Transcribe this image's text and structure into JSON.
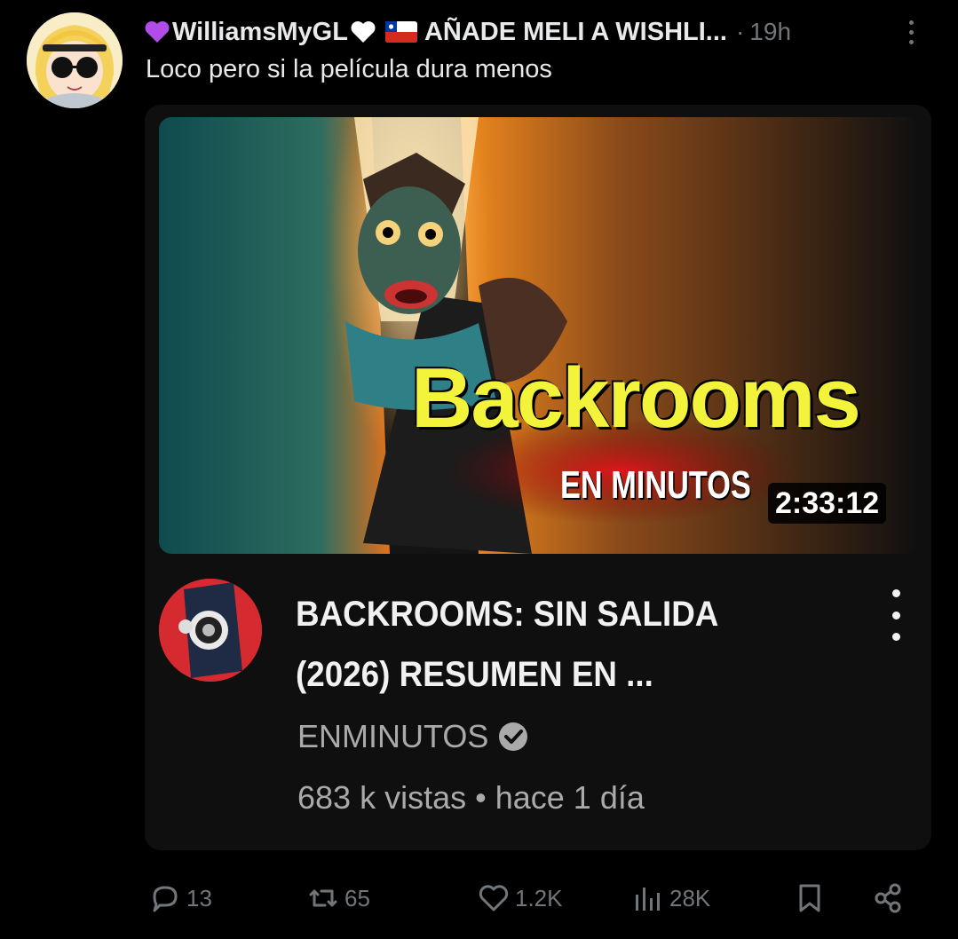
{
  "post": {
    "display_name": "WilliamsMyGL",
    "display_name_suffix": "AÑADE MELI A WISHLI...",
    "separator": "·",
    "time": "19h",
    "text": "Loco pero si la película dura menos"
  },
  "video": {
    "thumbnail_title": "Backrooms",
    "thumbnail_subtitle": "EN MINUTOS",
    "duration": "2:33:12",
    "title_line1": "BACKROOMS: SIN SALIDA",
    "title_line2": "(2026) RESUMEN EN ...",
    "channel": "ENMINUTOS",
    "views": "683 k vistas",
    "stats_separator": "•",
    "age": "hace 1 día"
  },
  "actions": {
    "replies": "13",
    "reposts": "65",
    "likes": "1.2K",
    "views": "28K"
  },
  "icons": {
    "more": "more-vertical-icon",
    "reply": "reply-icon",
    "repost": "repost-icon",
    "like": "heart-icon",
    "views": "views-chart-icon",
    "bookmark": "bookmark-icon",
    "share": "share-icon",
    "verified": "verified-check-icon"
  },
  "colors": {
    "background": "#000000",
    "muted": "#71767b",
    "card": "#0f0f0f",
    "thumb_title": "#f3f33b",
    "purple_heart": "#b04de8"
  }
}
